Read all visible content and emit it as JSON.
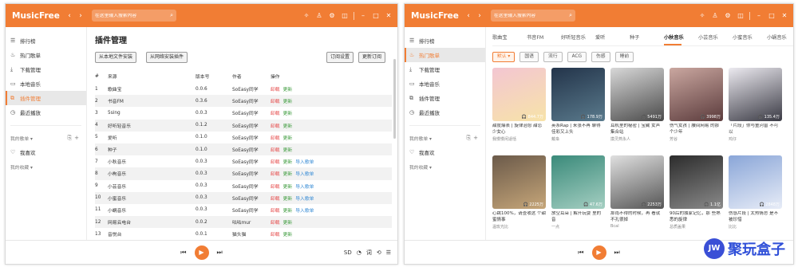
{
  "app": {
    "name": "MusicFree",
    "search_placeholder": "在这里输入搜索内容",
    "nav_back": "‹",
    "nav_forward": "›",
    "titlebar_icons": [
      "theme-icon",
      "shirt-icon",
      "settings-icon",
      "minimize-to-tray-icon",
      "minimize-icon",
      "maximize-icon",
      "close-icon"
    ],
    "accent": "#f17d34"
  },
  "sidebar": {
    "items": [
      {
        "label": "排行榜",
        "icon": "chart-icon"
      },
      {
        "label": "热门歌单",
        "icon": "fire-icon"
      },
      {
        "label": "下载管理",
        "icon": "download-icon"
      },
      {
        "label": "本地音乐",
        "icon": "folder-icon"
      },
      {
        "label": "插件管理",
        "icon": "plugin-icon"
      },
      {
        "label": "最近播放",
        "icon": "clock-icon"
      }
    ],
    "my_playlists": "我的歌单 ▾",
    "favorites": "我喜欢",
    "my_collections": "我的收藏 ▾"
  },
  "player": {
    "prev": "⏮",
    "play": "▶",
    "next": "⏭",
    "quality": "SD",
    "extras": [
      "speed-icon",
      "lyric-icon",
      "loop-icon",
      "playlist-icon"
    ]
  },
  "plugin_page": {
    "title": "插件管理",
    "install_local": "从本地文件安装",
    "install_network": "从网络安装插件",
    "subscribe_settings": "订阅设置",
    "update_subscription": "更新订阅",
    "headers": [
      "#",
      "来源",
      "版本号",
      "作者",
      "操作"
    ],
    "rows": [
      {
        "num": "1",
        "source": "歌曲宝",
        "version": "0.0.6",
        "author": "SoEasy同学",
        "ops": [
          "卸载",
          "更新"
        ]
      },
      {
        "num": "2",
        "source": "书音FM",
        "version": "0.3.6",
        "author": "SoEasy同学",
        "ops": [
          "卸载",
          "更新"
        ]
      },
      {
        "num": "3",
        "source": "5sing",
        "version": "0.0.3",
        "author": "SoEasy同学",
        "ops": [
          "卸载",
          "更新"
        ]
      },
      {
        "num": "4",
        "source": "好听轻音乐",
        "version": "0.1.2",
        "author": "SoEasy同学",
        "ops": [
          "卸载",
          "更新"
        ]
      },
      {
        "num": "5",
        "source": "爱听",
        "version": "0.1.0",
        "author": "SoEasy同学",
        "ops": [
          "卸载",
          "更新"
        ]
      },
      {
        "num": "6",
        "source": "种子",
        "version": "0.1.0",
        "author": "SoEasy同学",
        "ops": [
          "卸载",
          "更新"
        ]
      },
      {
        "num": "7",
        "source": "小秋音乐",
        "version": "0.0.3",
        "author": "SoEasy同学",
        "ops": [
          "卸载",
          "更新",
          "导入歌单"
        ]
      },
      {
        "num": "8",
        "source": "小枸音乐",
        "version": "0.0.3",
        "author": "SoEasy同学",
        "ops": [
          "卸载",
          "更新",
          "导入歌单"
        ]
      },
      {
        "num": "9",
        "source": "小芸音乐",
        "version": "0.0.3",
        "author": "SoEasy同学",
        "ops": [
          "卸载",
          "更新",
          "导入歌单"
        ]
      },
      {
        "num": "10",
        "source": "小蜜音乐",
        "version": "0.0.3",
        "author": "SoEasy同学",
        "ops": [
          "卸载",
          "更新",
          "导入歌单"
        ]
      },
      {
        "num": "11",
        "source": "小蜗音乐",
        "version": "0.0.3",
        "author": "SoEasy同学",
        "ops": [
          "卸载",
          "更新",
          "导入歌单"
        ]
      },
      {
        "num": "12",
        "source": "网易云电台",
        "version": "0.0.2",
        "author": "咕咕mur",
        "ops": [
          "卸载",
          "更新"
        ]
      },
      {
        "num": "13",
        "source": "音悦台",
        "version": "0.0.1",
        "author": "猫头猫",
        "ops": [
          "卸载",
          "更新"
        ]
      }
    ]
  },
  "discover_page": {
    "tabs": [
      "歌曲宝",
      "书音FM",
      "好听轻音乐",
      "爱听",
      "种子",
      "小秋音乐",
      "小芸音乐",
      "小蜜音乐",
      "小蜗音乐",
      "元力W"
    ],
    "active_tab": 5,
    "chips": [
      "默认 ▾",
      "国语",
      "流行",
      "ACG",
      "伤感",
      "睡前"
    ],
    "cards": [
      {
        "caption": "甜度爆表 | 旋律治愈 甜恋少女心",
        "author": "我慢慢闲适恬",
        "count": "844.7万",
        "color1": "#f3c6d2",
        "color2": "#f7e3a8"
      },
      {
        "caption": "英系Rap | 来张不再 聊得佳彩又上头",
        "author": "戴枭",
        "count": "178.9万",
        "color1": "#23344a",
        "color2": "#5a7a8c"
      },
      {
        "caption": "耳机里的秘密 | 宝藏 女声集合站",
        "author": "摸灵燕永人",
        "count": "5491万",
        "color1": "#d8d8d8",
        "color2": "#4a4a4a"
      },
      {
        "caption": "伤气女孩 | 腰间网易 的那个少年",
        "author": "芳谷",
        "count": "3998万",
        "color1": "#caa7a0",
        "color2": "#5b3b3c"
      },
      {
        "caption": "「片段」你与童河曾 不可以",
        "author": "鸡仔",
        "count": "135.4万",
        "color1": "#eceaf0",
        "color2": "#3a3a44"
      },
      {
        "caption": "心跳100%，请查收这 个甜蜜情事",
        "author": "温玫光比",
        "count": "2225万",
        "color1": "#6b5a4a",
        "color2": "#c6a679"
      },
      {
        "caption": "放空耳朵 | 解开玩耍 里的音",
        "author": "一点",
        "count": "47.6万",
        "color1": "#3a8a7a",
        "color2": "#a5cfc2"
      },
      {
        "caption": "那雨不得的时候，再 看就不孔很掉",
        "author": "Bcal",
        "count": "2253万",
        "color1": "#e0e0e0",
        "color2": "#555555"
      },
      {
        "caption": "90后的独家记忆，那 些熟悉的旋律",
        "author": "总质盖果",
        "count": "1.1亿",
        "color1": "#2c2c2c",
        "color2": "#8a8a8a"
      },
      {
        "caption": "伤感片段 | 太热情总 是不被珍惜",
        "author": "比比",
        "count": "2848万",
        "color1": "#8aa6d8",
        "color2": "#e7ecf7"
      }
    ]
  },
  "watermark": {
    "logo": "JW",
    "text": "聚玩盒子"
  }
}
